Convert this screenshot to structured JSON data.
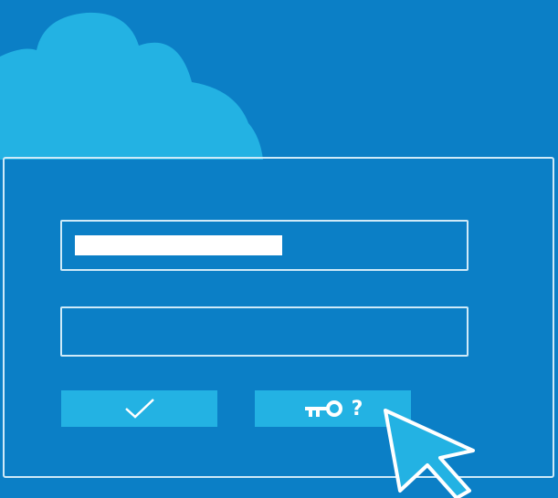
{
  "colors": {
    "background": "#0b7fc6",
    "cloud": "#23b2e3",
    "outline": "#cfeaf8",
    "button": "#23b2e3",
    "text_fill": "#ffffff"
  },
  "login_form": {
    "username_field": {
      "value": "",
      "placeholder": ""
    },
    "password_field": {
      "value": "",
      "placeholder": ""
    },
    "confirm_button": {
      "icon": "checkmark-icon"
    },
    "forgot_password_button": {
      "icon": "key-icon",
      "label": "?"
    }
  },
  "icons": [
    "cloud-icon",
    "checkmark-icon",
    "key-icon",
    "mouse-pointer-icon"
  ]
}
